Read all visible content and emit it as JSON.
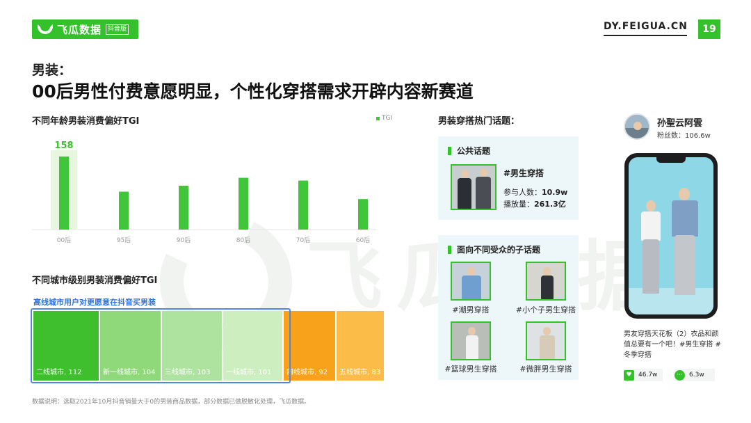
{
  "header": {
    "logo_text": "飞瓜数据",
    "logo_tag": "抖音版",
    "site": "DY.FEIGUA.CN",
    "page_number": "19"
  },
  "title": {
    "section": "男装：",
    "headline": "00后男性付费意愿明显，个性化穿搭需求开辟内容新赛道"
  },
  "watermark_text": "飞瓜数据",
  "chart_data": [
    {
      "type": "bar",
      "title": "不同年龄男装消费偏好TGI",
      "legend": [
        "TGI"
      ],
      "categories": [
        "00后",
        "95后",
        "90后",
        "80后",
        "70后",
        "60后"
      ],
      "values": [
        158,
        82,
        95,
        112,
        106,
        66
      ],
      "data_labels": [
        "158"
      ],
      "color": "#41c53a",
      "highlight_category": "00后"
    },
    {
      "type": "bar",
      "title": "不同城市级别男装消费偏好TGI",
      "subtitle": "高线城市用户对更愿意在抖音买男装",
      "categories": [
        "二线城市",
        "新一线城市",
        "三线城市",
        "一线城市",
        "四线城市",
        "五线城市"
      ],
      "values": [
        112,
        104,
        103,
        101,
        92,
        83
      ],
      "labels": [
        "二线城市, 112",
        "新一线城市, 104",
        "三线城市, 103",
        "一线城市, 101",
        "四线城市, 92",
        "五线城市, 83"
      ],
      "colors": [
        "#3fbf2e",
        "#8fd97a",
        "#aee39f",
        "#cdeebf",
        "#f7a21a",
        "#fbbd48"
      ]
    }
  ],
  "topics": {
    "title": "男装穿搭热门话题：",
    "public": {
      "heading": "公共话题",
      "tag": "#男生穿搭",
      "participants_label": "参与人数：",
      "participants": "10.9w",
      "plays_label": "播放量：",
      "plays": "261.3亿"
    },
    "audience": {
      "heading": "面向不同受众的子话题",
      "items": [
        "#潮男穿搭",
        "#小个子男生穿搭",
        "#篮球男生穿搭",
        "#微胖男生穿搭"
      ]
    }
  },
  "influencer": {
    "name": "孙聖云阿雲",
    "fans": "粉丝数：106.6w",
    "caption": "男友穿搭天花板（2）衣品和颜值总要有一个吧！#男生穿搭 #冬季穿搭",
    "likes": "46.7w",
    "comments": "6.3w"
  },
  "footnote": "数据说明：选取2021年10月抖音销量大于0的男装商品数据，部分数据已做脱敏化处理，飞瓜数据。"
}
